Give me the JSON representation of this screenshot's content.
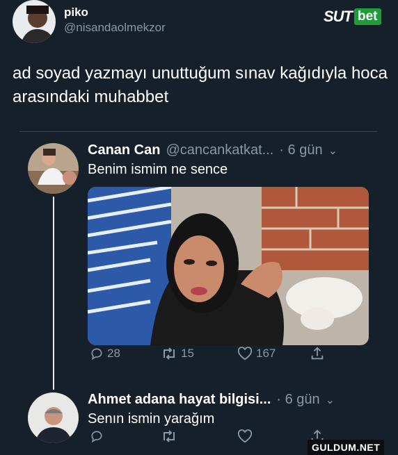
{
  "header": {
    "display_name": "piko",
    "handle": "@nisandaolmekzor",
    "avatar_icon": "user-avatar-icon"
  },
  "brand": {
    "part1": "SUT",
    "part2": "bet",
    "accent": "#1f9b3a"
  },
  "caption": "ad soyad yazmayı unuttuğum sınav kağıdıyla hoca arasındaki muhabbet",
  "replies": [
    {
      "name": "Canan Can",
      "handle": "@cancankatkat...",
      "time": "· 6 gün",
      "text": "Benim ismim ne sence",
      "has_photo": true,
      "stats": {
        "replies": "28",
        "retweets": "15",
        "likes": "167"
      }
    },
    {
      "name": "Ahmet adana hayat bilgisi...",
      "time": "· 6 gün",
      "text": "Senın ismin yarağım",
      "stats": {
        "replies": "",
        "retweets": "",
        "likes": ""
      }
    }
  ],
  "icons": {
    "reply": "reply-icon",
    "retweet": "retweet-icon",
    "like": "heart-icon",
    "share": "share-icon",
    "more": "chevron-down-icon"
  },
  "watermark": "GULDUM.NET",
  "colors": {
    "background": "#15202b",
    "muted": "#8b98a5",
    "divider": "#38444d"
  }
}
